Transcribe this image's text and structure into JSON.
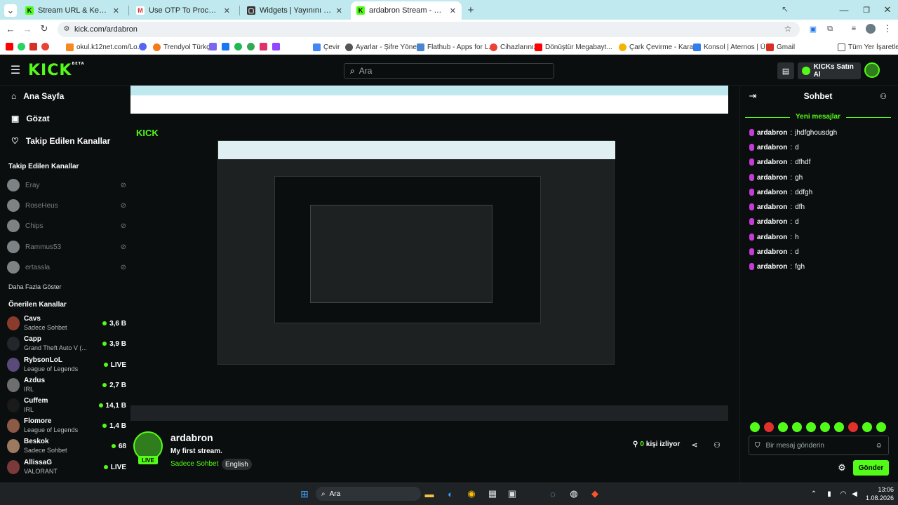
{
  "browser": {
    "tabs": [
      {
        "title": "Stream URL & Key - Kick Dashb",
        "icon": "kick-icon",
        "color": "#53fc18"
      },
      {
        "title": "Use OTP To Proceed - ardacagi",
        "icon": "gmail-icon",
        "color": "#d93025"
      },
      {
        "title": "Widgets | Yayınını güçlendirmel",
        "icon": "widget-icon",
        "color": "#333333"
      },
      {
        "title": "ardabron Stream - Watch Live o",
        "icon": "kick-icon",
        "color": "#53fc18"
      }
    ],
    "new_tab": "+",
    "url": "kick.com/ardabron",
    "bookmarks": [
      "okul.k12net.com/Lo...",
      "Trendyol Türkçe",
      "Çevir",
      "Ayarlar - Şifre Yönet...",
      "Flathub - Apps for L...",
      "Cihazlarınız",
      "Dönüştür Megabayt...",
      "Çark Çevirme - Kara...",
      "Konsol | Aternos | Ü...",
      "Gmail"
    ],
    "all_bookmarks": "Tüm Yer İşaretleri"
  },
  "kick": {
    "logo": "KICK",
    "logo_badge": "BETA",
    "search_placeholder": "Ara",
    "buy_kicks": "KICKs Satın Al",
    "nav": [
      {
        "label": "Ana Sayfa",
        "icon": "home-icon"
      },
      {
        "label": "Gözat",
        "icon": "browse-icon"
      },
      {
        "label": "Takip Edilen Kanallar",
        "icon": "heart-icon"
      }
    ],
    "followed_header": "Takip Edilen Kanallar",
    "followed": [
      "Eray",
      "RoseHeus",
      "Chips",
      "Rammus53",
      "ertassla"
    ],
    "show_more": "Daha Fazla Göster",
    "recommended_header": "Önerilen Kanallar",
    "recommended": [
      {
        "name": "Cavs",
        "category": "Sadece Sohbet",
        "viewers": "3,6 B"
      },
      {
        "name": "Capp",
        "category": "Grand Theft Auto V (...",
        "viewers": "3,9 B"
      },
      {
        "name": "RybsonLoL",
        "category": "League of Legends",
        "viewers": "LIVE"
      },
      {
        "name": "Azdus",
        "category": "IRL",
        "viewers": "2,7 B"
      },
      {
        "name": "Cuffem",
        "category": "IRL",
        "viewers": "14,1 B"
      },
      {
        "name": "Flomore",
        "category": "League of Legends",
        "viewers": "1,4 B"
      },
      {
        "name": "Beskok",
        "category": "Sadece Sohbet",
        "viewers": "68"
      },
      {
        "name": "AllissaG",
        "category": "VALORANT",
        "viewers": "LIVE"
      }
    ],
    "stream": {
      "channel": "ardabron",
      "title": "My first stream.",
      "category": "Sadece Sohbet",
      "language": "English",
      "live_badge": "LIVE",
      "viewers_count": "0",
      "viewers_label": "kişi izliyor"
    },
    "chat": {
      "title": "Sohbet",
      "new_messages": "Yeni mesajlar",
      "messages": [
        {
          "user": "ardabron",
          "text": "jhdfghousdgh"
        },
        {
          "user": "ardabron",
          "text": "d"
        },
        {
          "user": "ardabron",
          "text": "dfhdf"
        },
        {
          "user": "ardabron",
          "text": "gh"
        },
        {
          "user": "ardabron",
          "text": "ddfgh"
        },
        {
          "user": "ardabron",
          "text": "dfh"
        },
        {
          "user": "ardabron",
          "text": "d"
        },
        {
          "user": "ardabron",
          "text": "h"
        },
        {
          "user": "ardabron",
          "text": "d"
        },
        {
          "user": "ardabron",
          "text": "fgh"
        }
      ],
      "input_placeholder": "Bir mesaj gönderin",
      "send_label": "Gönder"
    }
  },
  "taskbar": {
    "search": "Ara",
    "time": "13:06",
    "date": "1.08.2026"
  }
}
